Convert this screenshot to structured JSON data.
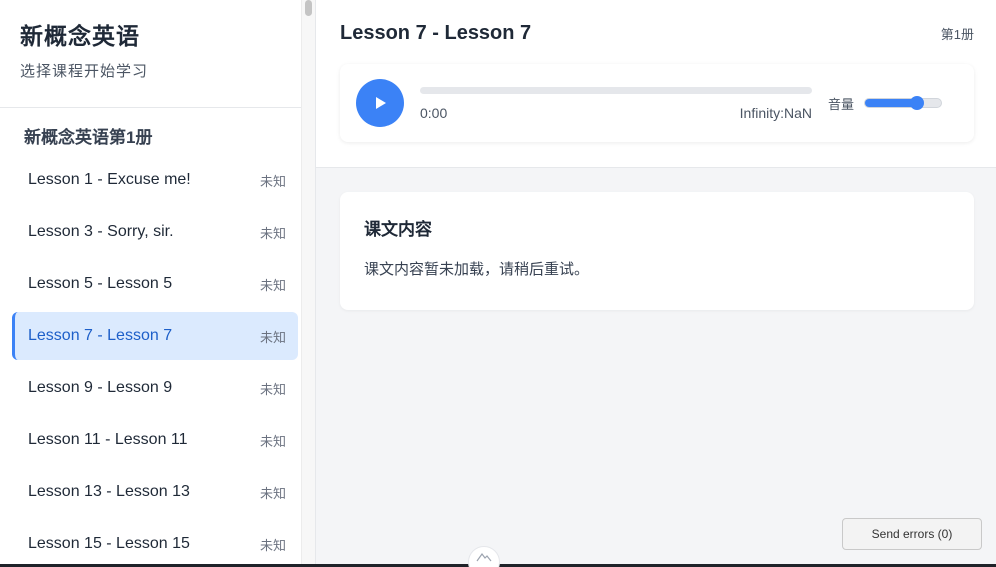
{
  "sidebar": {
    "app_title": "新概念英语",
    "app_subtitle": "选择课程开始学习",
    "book_title": "新概念英语第1册",
    "lessons": [
      {
        "name": "Lesson 1 - Excuse me!",
        "status": "未知",
        "active": false
      },
      {
        "name": "Lesson 3 - Sorry, sir.",
        "status": "未知",
        "active": false
      },
      {
        "name": "Lesson 5 - Lesson 5",
        "status": "未知",
        "active": false
      },
      {
        "name": "Lesson 7 - Lesson 7",
        "status": "未知",
        "active": true
      },
      {
        "name": "Lesson 9 - Lesson 9",
        "status": "未知",
        "active": false
      },
      {
        "name": "Lesson 11 - Lesson 11",
        "status": "未知",
        "active": false
      },
      {
        "name": "Lesson 13 - Lesson 13",
        "status": "未知",
        "active": false
      },
      {
        "name": "Lesson 15 - Lesson 15",
        "status": "未知",
        "active": false
      }
    ]
  },
  "player": {
    "lesson_title": "Lesson 7 - Lesson 7",
    "book_label": "第1册",
    "current_time": "0:00",
    "duration": "Infinity:NaN",
    "progress": 0,
    "volume_label": "音量",
    "volume": 0.68,
    "play_icon": "play-icon"
  },
  "content": {
    "title": "课文内容",
    "text": "课文内容暂未加载，请稍后重试。"
  },
  "footer": {
    "send_errors_label": "Send errors (0)"
  },
  "colors": {
    "accent": "#3b82f6",
    "active_bg": "#dbeafe",
    "active_text": "#1d5fc9",
    "main_bg": "#f4f5f7"
  }
}
